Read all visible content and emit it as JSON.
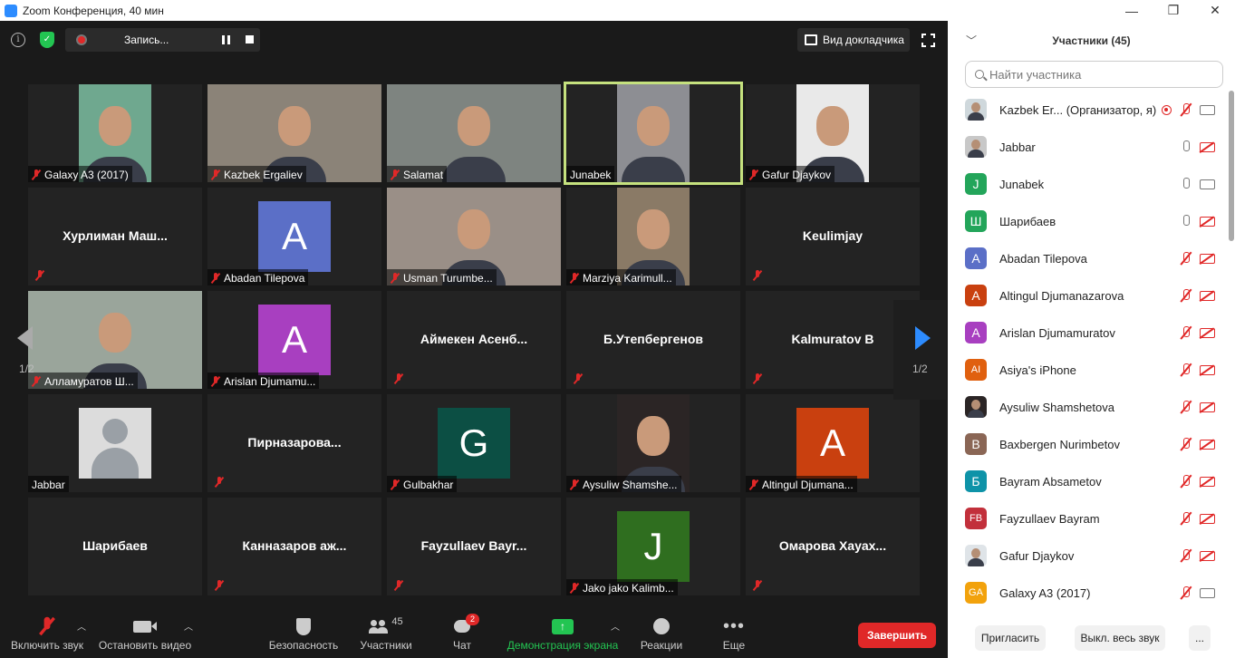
{
  "window": {
    "title": "Zoom Конференция, 40 мин",
    "controls": [
      "—",
      "❐",
      "✕"
    ]
  },
  "topbar": {
    "info_glyph": "i",
    "recording_label": "Запись...",
    "speaker_view_label": "Вид докладчика"
  },
  "pager": {
    "left": "1/2",
    "right": "1/2"
  },
  "tiles": [
    {
      "name": "Galaxy A3 (2017)",
      "muted": true,
      "kind": "photo",
      "bg": "#6fa88f"
    },
    {
      "name": "Kazbek Ergaliev",
      "muted": true,
      "kind": "photo",
      "bg": "#8b8378"
    },
    {
      "name": "Salamat",
      "muted": true,
      "kind": "photo",
      "bg": "#7e8480"
    },
    {
      "name": "Junabek",
      "muted": false,
      "kind": "photo",
      "bg": "#8d8e93",
      "active": true
    },
    {
      "name": "Gafur Djaykov",
      "muted": true,
      "kind": "photo",
      "bg": "#e9e9e9"
    },
    {
      "name": "Хурлиман Маш...",
      "muted": true,
      "kind": "text"
    },
    {
      "name": "Abadan Tilepova",
      "muted": true,
      "kind": "letter",
      "letter": "A",
      "bg": "#5b6fc7"
    },
    {
      "name": "Usman Turumbe...",
      "muted": true,
      "kind": "photo",
      "bg": "#9a8f87"
    },
    {
      "name": "Marziya Karimull...",
      "muted": true,
      "kind": "photo",
      "bg": "#8a7a66"
    },
    {
      "name": "Keulimjay",
      "muted": true,
      "kind": "text"
    },
    {
      "name": "Алламуратов Ш...",
      "muted": true,
      "kind": "photo",
      "bg": "#9aa59b"
    },
    {
      "name": "Arislan Djumamu...",
      "muted": true,
      "kind": "letter",
      "letter": "A",
      "bg": "#a83fc0"
    },
    {
      "name": "Аймекен Асенб...",
      "muted": true,
      "kind": "text"
    },
    {
      "name": "Б.Утепбергенов",
      "muted": true,
      "kind": "text"
    },
    {
      "name": "Kalmuratov B",
      "muted": true,
      "kind": "text"
    },
    {
      "name": "Jabbar",
      "muted": false,
      "kind": "avatar",
      "bg": "#dcdcdc"
    },
    {
      "name": "Пирназарова...",
      "muted": true,
      "kind": "text"
    },
    {
      "name": "Gulbakhar",
      "muted": true,
      "kind": "letter",
      "letter": "G",
      "bg": "#0c4f44"
    },
    {
      "name": "Aysuliw Shamshe...",
      "muted": true,
      "kind": "photo",
      "bg": "#2b2525"
    },
    {
      "name": "Altingul Djumana...",
      "muted": true,
      "kind": "letter",
      "letter": "A",
      "bg": "#c9400f"
    },
    {
      "name": "Шарибаев",
      "muted": false,
      "kind": "text"
    },
    {
      "name": "Канназаров аж...",
      "muted": true,
      "kind": "text"
    },
    {
      "name": "Fayzullaev Bayr...",
      "muted": true,
      "kind": "text"
    },
    {
      "name": "Jako jako Kalimb...",
      "muted": true,
      "kind": "letter",
      "letter": "J",
      "bg": "#2f6e1f"
    },
    {
      "name": "Омарова Хаyах...",
      "muted": true,
      "kind": "text"
    }
  ],
  "toolbar": {
    "mic_label": "Включить звук",
    "video_label": "Остановить видео",
    "security_label": "Безопасность",
    "participants_label": "Участники",
    "participants_count": "45",
    "chat_label": "Чат",
    "chat_badge": "2",
    "share_label": "Демонстрация экрана",
    "reactions_label": "Реакции",
    "more_label": "Еще",
    "end_label": "Завершить",
    "share_color": "#23c552",
    "end_color": "#e02828"
  },
  "sidebar": {
    "title": "Участники (45)",
    "search_placeholder": "Найти участника",
    "participants": [
      {
        "name": "Kazbek Er... (Организатор, я)",
        "avatar": "",
        "color": "#cfd8dc",
        "mic": "off",
        "video": "on",
        "recording": true,
        "photo": true
      },
      {
        "name": "Jabbar",
        "avatar": "",
        "color": "#c8c8c8",
        "mic": "on",
        "video": "off",
        "photo": true
      },
      {
        "name": "Junabek",
        "avatar": "J",
        "color": "#23a55a",
        "mic": "on",
        "video": "on"
      },
      {
        "name": "Шарибаев",
        "avatar": "Ш",
        "color": "#23a55a",
        "mic": "on",
        "video": "off"
      },
      {
        "name": "Abadan Tilepova",
        "avatar": "A",
        "color": "#5b6fc7",
        "mic": "off",
        "video": "off"
      },
      {
        "name": "Altingul Djumanazarova",
        "avatar": "A",
        "color": "#c9400f",
        "mic": "off",
        "video": "off"
      },
      {
        "name": "Arislan Djumamuratov",
        "avatar": "A",
        "color": "#a83fc0",
        "mic": "off",
        "video": "off"
      },
      {
        "name": "Asiya's iPhone",
        "avatar": "AI",
        "color": "#e0600f",
        "mic": "off",
        "video": "off"
      },
      {
        "name": "Aysuliw Shamshetova",
        "avatar": "",
        "color": "#2b2525",
        "mic": "off",
        "video": "off",
        "photo": true
      },
      {
        "name": "Baxbergen Nurimbetov",
        "avatar": "B",
        "color": "#8a6655",
        "mic": "off",
        "video": "off"
      },
      {
        "name": "Bayram Absametov",
        "avatar": "Б",
        "color": "#0e93a8",
        "mic": "off",
        "video": "off"
      },
      {
        "name": "Fayzullaev Bayram",
        "avatar": "FB",
        "color": "#c2303b",
        "mic": "off",
        "video": "off"
      },
      {
        "name": "Gafur Djaykov",
        "avatar": "",
        "color": "#dfe4e8",
        "mic": "off",
        "video": "off",
        "photo": true
      },
      {
        "name": "Galaxy A3 (2017)",
        "avatar": "GA",
        "color": "#f2a20c",
        "mic": "off",
        "video": "on"
      }
    ],
    "invite_label": "Пригласить",
    "mute_all_label": "Выкл. весь звук",
    "more_label": "..."
  }
}
